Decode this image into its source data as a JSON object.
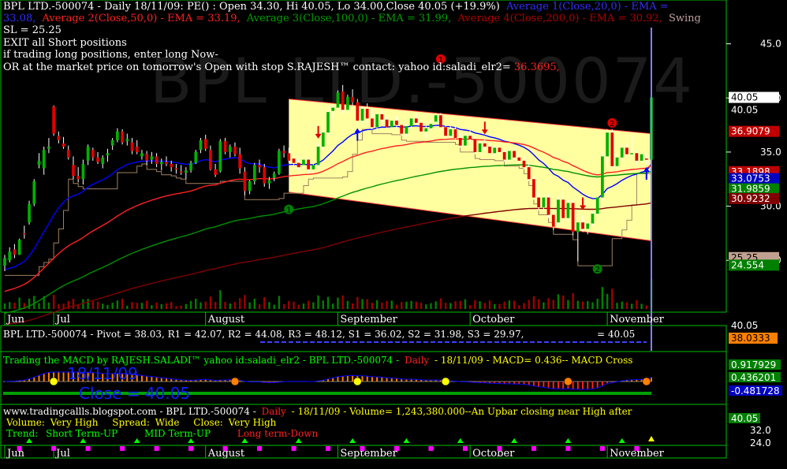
{
  "colors": {
    "background": "#000000",
    "frame": "#00c000",
    "up": "#00b000",
    "down": "#e00000",
    "channel": "#ffffa0",
    "ema20": "#0000ff",
    "ema50": "#ff2020",
    "ema100": "#009000",
    "ema200": "#800000",
    "swing": "#a08060"
  },
  "header": {
    "line1_a": "BPL LTD.-500074 - Daily 18/11/09: PE() : Open 34.30, Hi 40.05, Lo 34.00,Close 40.05 (+19.9%)",
    "line1_b": "Average 1(Close,20,0) - EMA =",
    "line2_a": "33.08,",
    "line2_b": "Average 2(Close,50,0) - EMA = 33.19,",
    "line2_c": "Average 3(Close,100,0) - EMA = 31.99,",
    "line2_d": "Average 4(Close,200,0) - EMA = 30.92,",
    "line2_e": "Swing",
    "line3": "SL = 25.25",
    "line4": "EXIT all Short positions",
    "line5": "if trading long positions, enter long Now-",
    "line6_a": "OR at the market price on tomorrow's Open with stop S.RAJESH™ contact: yahoo id:saladi_elr2=",
    "line6_b": "36.3695,",
    "watermark": "BPL LTD.-500074"
  },
  "price_labels": [
    {
      "text": "40.05",
      "bg": "#ffffff",
      "fg": "#000000",
      "value": 40.05
    },
    {
      "text": "40.05",
      "bg": "#000000",
      "fg": "#ffffff",
      "value": 39.4
    },
    {
      "text": "36.9079",
      "bg": "#c00000",
      "fg": "#ffffff",
      "value": 36.91
    },
    {
      "text": "33.1898",
      "bg": "#c00000",
      "fg": "#ffffff",
      "value": 33.19
    },
    {
      "text": "33.0753",
      "bg": "#0000c0",
      "fg": "#ffffff",
      "value": 32.55
    },
    {
      "text": "31.9859",
      "bg": "#008000",
      "fg": "#ffffff",
      "value": 31.6
    },
    {
      "text": "30.9232",
      "bg": "#800000",
      "fg": "#ffffff",
      "value": 30.7
    },
    {
      "text": "25.25",
      "bg": "#c0a090",
      "fg": "#000000",
      "value": 25.25
    },
    {
      "text": "24.554",
      "bg": "#008000",
      "fg": "#ffffff",
      "value": 24.55
    }
  ],
  "chart_data": {
    "type": "candlestick",
    "title": "BPL LTD.-500074 - Daily 18/11/09",
    "y_ticks": [
      "45.0",
      "40.0",
      "35.0",
      "30.0",
      "25.0"
    ],
    "y_tick_values": [
      45,
      40,
      35,
      30,
      25
    ],
    "ylim": [
      20.5,
      46.5
    ],
    "x_labels": [
      "Jun",
      "Jul",
      "August",
      "September",
      "October",
      "November"
    ],
    "x_label_index": [
      0,
      10,
      41,
      68,
      95,
      123
    ],
    "candles": [
      [
        24.5,
        25.5,
        24,
        25.2
      ],
      [
        25,
        26.2,
        24.8,
        25.8
      ],
      [
        26,
        26.5,
        25.2,
        25.5
      ],
      [
        25.5,
        27,
        25.5,
        26.9
      ],
      [
        27.5,
        28.2,
        27,
        27.4
      ],
      [
        28.5,
        30.5,
        28.3,
        30.2
      ],
      [
        30.2,
        32.5,
        30,
        32.3
      ],
      [
        33.8,
        34.9,
        33.5,
        34.2
      ],
      [
        33.5,
        35.5,
        32.9,
        35.2
      ],
      [
        35.3,
        36.3,
        34.9,
        35.5
      ],
      [
        39.2,
        39.3,
        36.5,
        36.7
      ],
      [
        36.5,
        36.9,
        35.8,
        36.1
      ],
      [
        35.8,
        36.4,
        35.3,
        35.5
      ],
      [
        35.2,
        35.6,
        34.3,
        34.5
      ],
      [
        33.8,
        34.6,
        32.5,
        32.8
      ],
      [
        32.8,
        33.6,
        32.2,
        32.5
      ],
      [
        32.5,
        34.3,
        32,
        33.9
      ],
      [
        34.2,
        35.7,
        33.8,
        35.5
      ],
      [
        35.2,
        35.4,
        34.2,
        34.5
      ],
      [
        34.5,
        35,
        33.9,
        34.1
      ],
      [
        33.9,
        34.7,
        33.5,
        34.5
      ],
      [
        34.7,
        35.3,
        34.1,
        34.9
      ],
      [
        35.6,
        36.3,
        35.2,
        36.1
      ],
      [
        36.1,
        37.2,
        35.9,
        36.9
      ],
      [
        36.9,
        37.1,
        35.7,
        35.9
      ],
      [
        36,
        36.7,
        35.6,
        36.2
      ],
      [
        35.9,
        36.3,
        34.8,
        35.1
      ],
      [
        35.5,
        36.1,
        34.8,
        35
      ],
      [
        34.6,
        35.2,
        34.3,
        34.9
      ],
      [
        34.8,
        35.1,
        33.8,
        34.2
      ],
      [
        34.3,
        35,
        33.9,
        34.6
      ],
      [
        34.6,
        34.9,
        33.6,
        33.9
      ],
      [
        33.9,
        34.4,
        33.3,
        34.1
      ],
      [
        34.1,
        34.6,
        33.7,
        33.9
      ],
      [
        33.9,
        34.2,
        33.2,
        33.6
      ],
      [
        33.5,
        33.9,
        33,
        33.4
      ],
      [
        33.2,
        33.8,
        32.9,
        33.1
      ],
      [
        33.1,
        33.6,
        32.5,
        33.3
      ],
      [
        33.3,
        34.2,
        33.1,
        34
      ],
      [
        34,
        35.2,
        33.9,
        35
      ],
      [
        35.2,
        36.3,
        34.9,
        36.1
      ],
      [
        36.2,
        36.6,
        35.1,
        35.3
      ],
      [
        35.2,
        35.6,
        33.3,
        33.4
      ],
      [
        33.4,
        33.9,
        32.7,
        32.9
      ],
      [
        33.2,
        36.2,
        33.1,
        36
      ],
      [
        36,
        36.3,
        34.8,
        35
      ],
      [
        35,
        35.7,
        34.5,
        35.5
      ],
      [
        35.5,
        35.9,
        34.6,
        34.8
      ],
      [
        34.8,
        35.4,
        33,
        33.5
      ],
      [
        33.2,
        33.6,
        31,
        31.4
      ],
      [
        31.4,
        32.4,
        31.1,
        32.3
      ],
      [
        32.3,
        34,
        32,
        33.8
      ],
      [
        33.8,
        34.3,
        33.1,
        33.6
      ],
      [
        33.6,
        33.9,
        31.8,
        32.1
      ],
      [
        32.1,
        32.7,
        31.6,
        32.4
      ],
      [
        32.6,
        33.2,
        32.3,
        33
      ],
      [
        33,
        35.3,
        32.9,
        35.1
      ],
      [
        35.1,
        35.6,
        34.5,
        34.9
      ],
      [
        34.9,
        35.4,
        34,
        34.2
      ],
      [
        34.4,
        34.8,
        33.5,
        34
      ],
      [
        34,
        34.4,
        33.3,
        33.6
      ],
      [
        33.8,
        34.6,
        33.5,
        34.3
      ],
      [
        34.3,
        34.5,
        33,
        33.4
      ],
      [
        33.4,
        34,
        33.1,
        33.8
      ],
      [
        33.8,
        35.8,
        33.6,
        35.5
      ],
      [
        35.5,
        37,
        35.2,
        36.8
      ],
      [
        36.8,
        38.9,
        36.5,
        38.7
      ],
      [
        38.8,
        39.4,
        38.2,
        39.1
      ],
      [
        39.1,
        40.7,
        38.9,
        40.5
      ],
      [
        40.6,
        41.2,
        38.6,
        38.9
      ],
      [
        38.9,
        40.3,
        38.6,
        40.1
      ],
      [
        40.1,
        40.8,
        39.3,
        39.6
      ],
      [
        39.6,
        39.9,
        37.5,
        37.9
      ],
      [
        37.9,
        39.2,
        37.7,
        39
      ],
      [
        39,
        39.5,
        37.7,
        38.1
      ],
      [
        38.1,
        38.9,
        37.1,
        37.3
      ],
      [
        37.3,
        38.7,
        37.1,
        38.5
      ],
      [
        38.5,
        38.9,
        37.7,
        38
      ],
      [
        38,
        38.3,
        37.1,
        37.3
      ],
      [
        37.3,
        38.2,
        37,
        37.9
      ],
      [
        37.9,
        38.4,
        37.2,
        37.5
      ],
      [
        37.5,
        37.8,
        36.5,
        36.7
      ],
      [
        36.7,
        37.6,
        36.4,
        37.4
      ],
      [
        37.4,
        38.3,
        37.2,
        38.1
      ],
      [
        38.1,
        38.6,
        37.5,
        37.7
      ],
      [
        37.7,
        38,
        36.7,
        36.9
      ],
      [
        36.9,
        37.4,
        36.3,
        37.2
      ],
      [
        37.2,
        37.9,
        37,
        37.6
      ],
      [
        37.8,
        38.6,
        37.5,
        38.4
      ],
      [
        38.4,
        38.6,
        37.1,
        37.3
      ],
      [
        37.3,
        37.6,
        36.3,
        36.5
      ],
      [
        36.5,
        37.4,
        36.3,
        37.1
      ],
      [
        37.1,
        37.5,
        36.1,
        36.3
      ],
      [
        36.3,
        36.8,
        35.4,
        35.6
      ],
      [
        35.6,
        36.7,
        35.5,
        36.5
      ],
      [
        36.5,
        37,
        35.9,
        36.2
      ],
      [
        36.2,
        36.5,
        34.8,
        35
      ],
      [
        35,
        36,
        34.7,
        35.8
      ],
      [
        35.8,
        36.2,
        35.2,
        35.5
      ],
      [
        35.5,
        35.9,
        34.7,
        34.9
      ],
      [
        34.9,
        35.6,
        34.6,
        35.4
      ],
      [
        35.4,
        35.7,
        34.8,
        35
      ],
      [
        35,
        35.2,
        34.1,
        34.3
      ],
      [
        34.3,
        35.3,
        34.1,
        35.1
      ],
      [
        35.1,
        35.4,
        34.3,
        34.5
      ],
      [
        34.5,
        34.7,
        33.9,
        34.2
      ],
      [
        34.2,
        34.6,
        33.4,
        33.6
      ],
      [
        33.6,
        34,
        32.3,
        32.5
      ],
      [
        32.5,
        32.8,
        30.6,
        30.8
      ],
      [
        30.8,
        31.3,
        29.6,
        29.9
      ],
      [
        29.9,
        31,
        29.6,
        30.8
      ],
      [
        30.8,
        31.1,
        28.9,
        29.2
      ],
      [
        29.2,
        29.7,
        27.8,
        28.1
      ],
      [
        28.5,
        30.9,
        28.3,
        30.6
      ],
      [
        30.6,
        31.3,
        28.6,
        28.9
      ],
      [
        28.9,
        30.6,
        28.7,
        30.3
      ],
      [
        30.3,
        30.5,
        27.3,
        27.6
      ],
      [
        27.6,
        28.6,
        24.9,
        28.5
      ],
      [
        28.5,
        29.2,
        27.6,
        27.9
      ],
      [
        27.9,
        28.6,
        27.4,
        28.4
      ],
      [
        28.4,
        29.5,
        28.2,
        29.3
      ],
      [
        29.3,
        31,
        29.1,
        30.8
      ],
      [
        30.8,
        34.9,
        30.5,
        34.6
      ],
      [
        34.6,
        37.1,
        33.8,
        36.8
      ],
      [
        36.8,
        37.1,
        33.5,
        33.7
      ],
      [
        33.7,
        34.8,
        33.4,
        34.5
      ],
      [
        34.5,
        35.6,
        34.2,
        35.4
      ],
      [
        35.4,
        35.8,
        34.6,
        34.8
      ],
      [
        34.8,
        36.6,
        34.6,
        34.9
      ],
      [
        34.9,
        35.1,
        33.9,
        34.2
      ],
      [
        34.2,
        35.2,
        34,
        34.8
      ],
      [
        34.4,
        34.8,
        33.9,
        34.3
      ],
      [
        34.3,
        40.05,
        34,
        40.05
      ]
    ],
    "series": [
      {
        "name": "Average 1(Close,20,0) - EMA",
        "color": "#0000ff"
      },
      {
        "name": "Average 2(Close,50,0) - EMA",
        "color": "#ff2020"
      },
      {
        "name": "Average 3(Close,100,0) - EMA",
        "color": "#009000"
      },
      {
        "name": "Average 4(Close,200,0) - EMA",
        "color": "#800000"
      }
    ],
    "channel": {
      "upper_start": 39.9,
      "upper_end": 36.7,
      "lower_start": 31.3,
      "lower_end": 26.8,
      "start_index": 58,
      "end_index": 132
    },
    "sell_arrows": [
      64,
      98,
      118
    ],
    "buy_arrows": [
      72,
      131
    ],
    "wave_labels": [
      {
        "text": "1",
        "index": 58,
        "price": 29.7
      },
      {
        "text": "2",
        "index": 121,
        "price": 24.2
      },
      {
        "text": "2",
        "index": 124,
        "price": 37.7
      },
      {
        "text": "1",
        "index": 89,
        "price": 43.6
      }
    ],
    "pivot": {
      "text": "BPL LTD.-500074 - Pivot = 38.03, R1 = 42.07, R2 = 44.08, R3 = 48.12, S1 = 36.02, S2 = 31.98, S3 = 29.97,",
      "right": "= 40.05"
    },
    "macd": {
      "title": "Trading the MACD by RAJESH.SALADI™ yahoo id:saladi_elr2 - BPL LTD.-500074 -",
      "daily": "Daily",
      "rest": "- 18/11/09 - MACD=   0.436-- MACD Cross",
      "labels": [
        "0.917929",
        "0.436201",
        "-0.481728"
      ],
      "overlay_date": "18/11/09",
      "overlay_close": "Close = 40.05"
    },
    "volume": {
      "line1": "www.tradingcallls.blogspot.com - BPL LTD.-500074 -",
      "daily": "Daily",
      "line1b": "- 18/11/09 - Volume= 1,243,380.000--An Upbar closing near High after",
      "vol_label": "Volume:",
      "vol_value": "Very High",
      "spread_label": "Spread:",
      "spread_value": "Wide",
      "close_label": "Close:",
      "close_value": "Very High",
      "trend_label": "Trend:",
      "trend_short": "Short Term-UP",
      "trend_mid": "MID Term-UP",
      "trend_long": "Long term-Down",
      "right_labels": [
        "40.05",
        "32.0",
        "24.0"
      ]
    },
    "mid_labels": [
      "40.05",
      "38.0333"
    ]
  }
}
